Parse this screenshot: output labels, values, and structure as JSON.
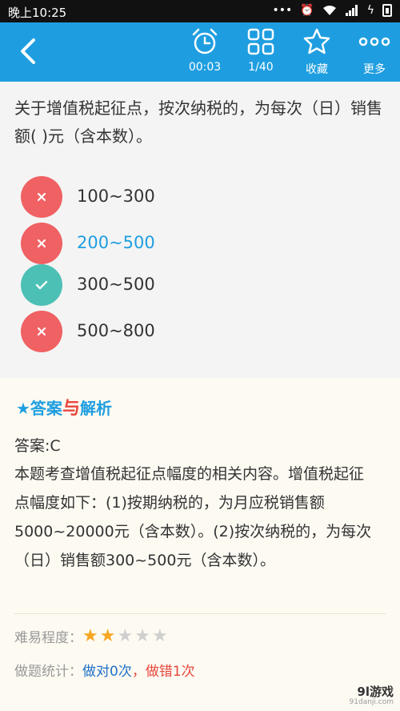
{
  "status_bar": {
    "time": "晚上10:25"
  },
  "toolbar": {
    "timer": "00:03",
    "progress": "1/40",
    "favorite": "收藏",
    "more": "更多"
  },
  "question": {
    "text": "关于增值税起征点，按次纳税的，为每次（日）销售额(   )元（含本数）。",
    "options": [
      {
        "text": "100~300",
        "state": "wrong"
      },
      {
        "text": "200~500",
        "state": "wrong"
      },
      {
        "text": "300~500",
        "state": "correct"
      },
      {
        "text": "500~800",
        "state": "wrong"
      }
    ]
  },
  "analysis": {
    "title_left": "★答案",
    "title_mid": "与",
    "title_right": "解析",
    "answer": "答案:C",
    "explanation": "本题考查增值税起征点幅度的相关内容。增值税起征点幅度如下：(1)按期纳税的，为月应税销售额5000~20000元（含本数）。(2)按次纳税的，为每次（日）销售额300~500元（含本数）。",
    "difficulty_label": "难易程度：",
    "difficulty_stars": 2,
    "difficulty_max": 5,
    "stats_label": "做题统计：",
    "stats_right": "做对0次",
    "stats_sep": "，",
    "stats_wrong": "做错1次"
  },
  "watermark": {
    "line1": "9l游戏",
    "line2": "91danji.com"
  },
  "colors": {
    "accent": "#1e9ee0",
    "wrong": "#f06163",
    "correct": "#4dc0b5",
    "highlight_text": "#1e9ee0",
    "star_on": "#f5a623",
    "star_off": "#cfcfcf"
  }
}
